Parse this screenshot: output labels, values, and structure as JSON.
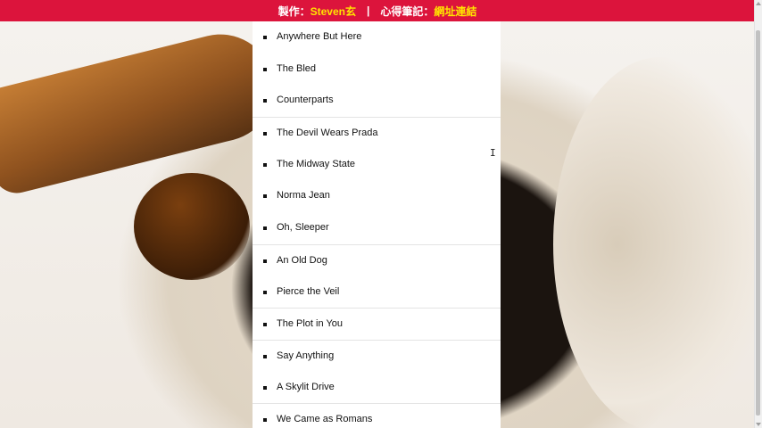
{
  "topbar": {
    "author_prefix": "製作：",
    "author": "Steven玄",
    "separator": "|",
    "notes_prefix": "心得筆記：",
    "notes_link": "網址連結",
    "background_color": "#dc143c",
    "highlight_color": "#ffe400"
  },
  "list": {
    "items": [
      {
        "label": "Anywhere But Here",
        "divider_before": false
      },
      {
        "label": "The Bled",
        "divider_before": false
      },
      {
        "label": "Counterparts",
        "divider_before": false
      },
      {
        "label": "The Devil Wears Prada",
        "divider_before": true
      },
      {
        "label": "The Midway State",
        "divider_before": false
      },
      {
        "label": "Norma Jean",
        "divider_before": false
      },
      {
        "label": "Oh, Sleeper",
        "divider_before": false
      },
      {
        "label": "An Old Dog",
        "divider_before": true
      },
      {
        "label": "Pierce the Veil",
        "divider_before": false
      },
      {
        "label": "The Plot in You",
        "divider_before": true
      },
      {
        "label": "Say Anything",
        "divider_before": true
      },
      {
        "label": "A Skylit Drive",
        "divider_before": false
      },
      {
        "label": "We Came as Romans",
        "divider_before": true
      }
    ]
  },
  "cursor_icon": "text-cursor-icon"
}
